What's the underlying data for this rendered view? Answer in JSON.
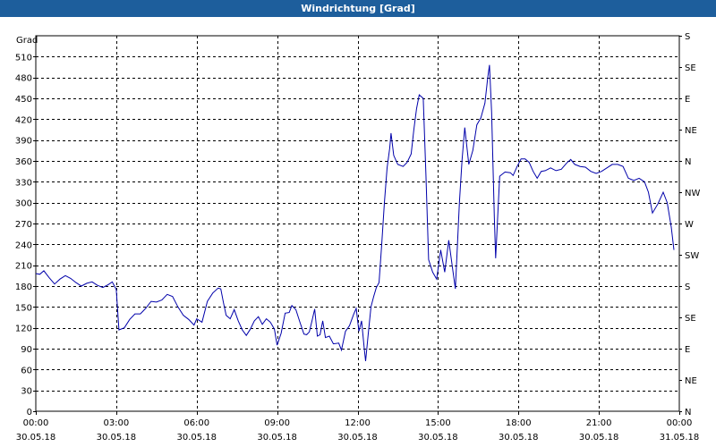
{
  "window": {
    "title": "Windrichtung [Grad]"
  },
  "chart_data": {
    "type": "line",
    "title": "Windrichtung [Grad]",
    "ylabel": "Grad",
    "ylim": [
      0,
      540
    ],
    "yticks": [
      0,
      30,
      60,
      90,
      120,
      150,
      180,
      210,
      240,
      270,
      300,
      330,
      360,
      390,
      420,
      450,
      480,
      510
    ],
    "right_ticks": [
      {
        "value": 0,
        "label": "N"
      },
      {
        "value": 45,
        "label": "NE"
      },
      {
        "value": 90,
        "label": "E"
      },
      {
        "value": 135,
        "label": "SE"
      },
      {
        "value": 180,
        "label": "S"
      },
      {
        "value": 225,
        "label": "SW"
      },
      {
        "value": 270,
        "label": "W"
      },
      {
        "value": 315,
        "label": "NW"
      },
      {
        "value": 360,
        "label": "N"
      },
      {
        "value": 405,
        "label": "NE"
      },
      {
        "value": 450,
        "label": "E"
      },
      {
        "value": 495,
        "label": "SE"
      },
      {
        "value": 540,
        "label": "S"
      }
    ],
    "xlim_hours": [
      0,
      24
    ],
    "xticks": [
      {
        "h": 0,
        "time": "00:00",
        "date": "30.05.18"
      },
      {
        "h": 3,
        "time": "03:00",
        "date": "30.05.18"
      },
      {
        "h": 6,
        "time": "06:00",
        "date": "30.05.18"
      },
      {
        "h": 9,
        "time": "09:00",
        "date": "30.05.18"
      },
      {
        "h": 12,
        "time": "12:00",
        "date": "30.05.18"
      },
      {
        "h": 15,
        "time": "15:00",
        "date": "30.05.18"
      },
      {
        "h": 18,
        "time": "18:00",
        "date": "30.05.18"
      },
      {
        "h": 21,
        "time": "21:00",
        "date": "30.05.18"
      },
      {
        "h": 24,
        "time": "00:00",
        "date": "31.05.18"
      }
    ],
    "grid": true,
    "line_color": "#0000aa",
    "series": [
      {
        "name": "",
        "points": [
          [
            0.0,
            198
          ],
          [
            0.15,
            197
          ],
          [
            0.3,
            202
          ],
          [
            0.5,
            192
          ],
          [
            0.7,
            183
          ],
          [
            0.9,
            190
          ],
          [
            1.1,
            195
          ],
          [
            1.3,
            191
          ],
          [
            1.5,
            185
          ],
          [
            1.7,
            180
          ],
          [
            1.9,
            184
          ],
          [
            2.1,
            186
          ],
          [
            2.3,
            181
          ],
          [
            2.5,
            178
          ],
          [
            2.7,
            182
          ],
          [
            2.85,
            186
          ],
          [
            3.0,
            175
          ],
          [
            3.1,
            117
          ],
          [
            3.3,
            120
          ],
          [
            3.5,
            132
          ],
          [
            3.7,
            140
          ],
          [
            3.9,
            140
          ],
          [
            4.1,
            148
          ],
          [
            4.3,
            158
          ],
          [
            4.5,
            157
          ],
          [
            4.7,
            160
          ],
          [
            4.9,
            168
          ],
          [
            5.1,
            165
          ],
          [
            5.3,
            150
          ],
          [
            5.5,
            138
          ],
          [
            5.7,
            132
          ],
          [
            5.9,
            124
          ],
          [
            6.0,
            133
          ],
          [
            6.2,
            128
          ],
          [
            6.4,
            158
          ],
          [
            6.6,
            170
          ],
          [
            6.8,
            177
          ],
          [
            6.9,
            176
          ],
          [
            7.0,
            156
          ],
          [
            7.1,
            138
          ],
          [
            7.25,
            133
          ],
          [
            7.4,
            146
          ],
          [
            7.55,
            130
          ],
          [
            7.7,
            117
          ],
          [
            7.85,
            109
          ],
          [
            8.0,
            118
          ],
          [
            8.15,
            130
          ],
          [
            8.3,
            136
          ],
          [
            8.45,
            125
          ],
          [
            8.6,
            133
          ],
          [
            8.75,
            128
          ],
          [
            8.9,
            118
          ],
          [
            9.0,
            95
          ],
          [
            9.15,
            112
          ],
          [
            9.3,
            141
          ],
          [
            9.45,
            142
          ],
          [
            9.55,
            152
          ],
          [
            9.7,
            146
          ],
          [
            9.85,
            128
          ],
          [
            10.0,
            111
          ],
          [
            10.1,
            110
          ],
          [
            10.2,
            114
          ],
          [
            10.3,
            130
          ],
          [
            10.4,
            147
          ],
          [
            10.5,
            108
          ],
          [
            10.6,
            110
          ],
          [
            10.7,
            130
          ],
          [
            10.8,
            106
          ],
          [
            10.95,
            108
          ],
          [
            11.1,
            97
          ],
          [
            11.3,
            98
          ],
          [
            11.4,
            88
          ],
          [
            11.55,
            115
          ],
          [
            11.7,
            123
          ],
          [
            11.85,
            139
          ],
          [
            11.95,
            148
          ],
          [
            12.05,
            115
          ],
          [
            12.15,
            130
          ],
          [
            12.25,
            90
          ],
          [
            12.3,
            72
          ],
          [
            12.4,
            112
          ],
          [
            12.5,
            150
          ],
          [
            12.6,
            165
          ],
          [
            12.7,
            178
          ],
          [
            12.8,
            185
          ],
          [
            12.9,
            240
          ],
          [
            13.0,
            300
          ],
          [
            13.1,
            350
          ],
          [
            13.2,
            378
          ],
          [
            13.25,
            400
          ],
          [
            13.35,
            368
          ],
          [
            13.5,
            355
          ],
          [
            13.7,
            352
          ],
          [
            13.85,
            358
          ],
          [
            14.0,
            370
          ],
          [
            14.1,
            405
          ],
          [
            14.2,
            435
          ],
          [
            14.3,
            455
          ],
          [
            14.45,
            450
          ],
          [
            14.55,
            340
          ],
          [
            14.65,
            218
          ],
          [
            14.8,
            200
          ],
          [
            14.95,
            190
          ],
          [
            15.1,
            232
          ],
          [
            15.25,
            200
          ],
          [
            15.4,
            246
          ],
          [
            15.55,
            203
          ],
          [
            15.65,
            176
          ],
          [
            15.8,
            300
          ],
          [
            15.9,
            362
          ],
          [
            16.0,
            408
          ],
          [
            16.15,
            355
          ],
          [
            16.3,
            375
          ],
          [
            16.45,
            412
          ],
          [
            16.6,
            422
          ],
          [
            16.75,
            443
          ],
          [
            16.85,
            478
          ],
          [
            16.92,
            498
          ],
          [
            17.0,
            430
          ],
          [
            17.1,
            280
          ],
          [
            17.15,
            220
          ],
          [
            17.3,
            338
          ],
          [
            17.5,
            344
          ],
          [
            17.7,
            343
          ],
          [
            17.8,
            339
          ],
          [
            17.95,
            352
          ],
          [
            18.1,
            363
          ],
          [
            18.25,
            363
          ],
          [
            18.4,
            358
          ],
          [
            18.55,
            345
          ],
          [
            18.7,
            335
          ],
          [
            18.85,
            345
          ],
          [
            19.0,
            346
          ],
          [
            19.2,
            350
          ],
          [
            19.4,
            346
          ],
          [
            19.6,
            348
          ],
          [
            19.8,
            357
          ],
          [
            19.95,
            362
          ],
          [
            20.1,
            355
          ],
          [
            20.3,
            352
          ],
          [
            20.5,
            351
          ],
          [
            20.7,
            345
          ],
          [
            20.9,
            342
          ],
          [
            21.1,
            345
          ],
          [
            21.3,
            350
          ],
          [
            21.5,
            355
          ],
          [
            21.7,
            355
          ],
          [
            21.9,
            352
          ],
          [
            22.1,
            335
          ],
          [
            22.3,
            332
          ],
          [
            22.5,
            335
          ],
          [
            22.7,
            330
          ],
          [
            22.85,
            315
          ],
          [
            23.0,
            285
          ],
          [
            23.2,
            298
          ],
          [
            23.4,
            315
          ],
          [
            23.55,
            300
          ],
          [
            23.7,
            265
          ],
          [
            23.8,
            232
          ]
        ]
      }
    ]
  }
}
